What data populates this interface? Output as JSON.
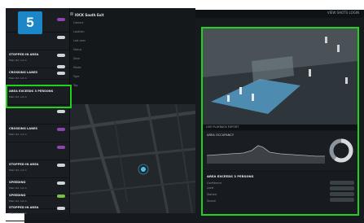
{
  "step_number": "5",
  "topbar": {
    "nav": "ALERTS   REPORT   SETUP",
    "right": "VIEW SHOTS   LOGIN"
  },
  "sidebar": {
    "items": [
      {
        "title": "",
        "sub": "",
        "toggle": "purple"
      },
      {
        "title": "",
        "sub": "",
        "toggle": "white"
      },
      {
        "title": "STOPPED IN AREA",
        "sub": "Main Rd, Lot A",
        "toggle": "white"
      },
      {
        "title": "",
        "sub": "",
        "toggle": "white"
      },
      {
        "title": "CROSSING LANES",
        "sub": "Main Rd, Lot A",
        "toggle": "white"
      },
      {
        "title": "AREA EXCEEDS 3 PERSONS",
        "sub": "Main Rd, Lot A",
        "toggle": "none"
      },
      {
        "title": "",
        "sub": "",
        "toggle": "white"
      },
      {
        "title": "CROSSING LANES",
        "sub": "Main Rd, Lot A",
        "toggle": "purple"
      },
      {
        "title": "",
        "sub": "",
        "toggle": "purple"
      },
      {
        "title": "STOPPED IN AREA",
        "sub": "Main Rd, Lot A",
        "toggle": "white"
      },
      {
        "title": "SPEEDING",
        "sub": "Main Rd, Lot A",
        "toggle": "white"
      },
      {
        "title": "SPEEDING",
        "sub": "Main Rd, Lot A",
        "toggle": "green"
      },
      {
        "title": "STOPPED IN AREA",
        "sub": "Main Rd, Lot A",
        "toggle": "white"
      }
    ]
  },
  "detail": {
    "title": "IOCK South Exit",
    "rows": [
      {
        "k": "Camera",
        "v": ""
      },
      {
        "k": "Location",
        "v": ""
      },
      {
        "k": "Last seen",
        "v": ""
      },
      {
        "k": "Status",
        "v": ""
      },
      {
        "k": "Zone",
        "v": ""
      },
      {
        "k": "Model",
        "v": ""
      },
      {
        "k": "Type",
        "v": ""
      },
      {
        "k": "Tag",
        "v": ""
      }
    ]
  },
  "video": {
    "controls": "LIVE   PLAYBACK   EXPORT"
  },
  "stats": {
    "label": "AREA OCCUPANCY"
  },
  "alert": {
    "title": "AREA EXCEEDS 3 PERSONS",
    "rows": [
      {
        "k": "Confidence",
        "v": "",
        "red": false
      },
      {
        "k": "Level",
        "v": "",
        "red": true
      },
      {
        "k": "Started",
        "v": "",
        "red": false
      },
      {
        "k": "Source",
        "v": "",
        "red": false
      }
    ],
    "buttons": [
      "",
      "",
      "",
      ""
    ],
    "link": ""
  }
}
